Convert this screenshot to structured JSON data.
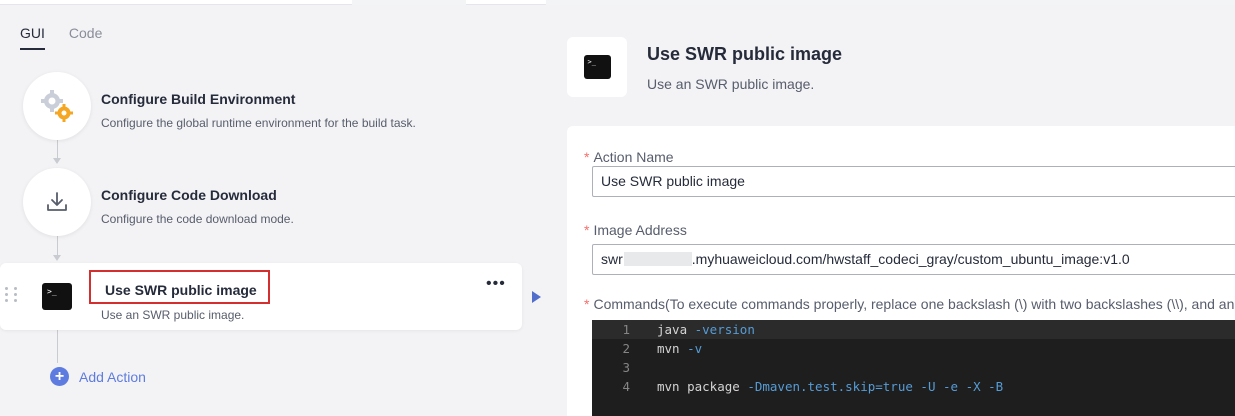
{
  "tabs": [
    {
      "label": "GUI",
      "active": true
    },
    {
      "label": "Code",
      "active": false
    }
  ],
  "steps": [
    {
      "title": "Configure Build Environment",
      "description": "Configure the global runtime environment for the build task.",
      "icon": "gear-icon"
    },
    {
      "title": "Configure Code Download",
      "description": "Configure the code download mode.",
      "icon": "download-icon"
    }
  ],
  "active_step": {
    "title": "Use SWR public image",
    "description": "Use an SWR public image.",
    "icon": "terminal-icon",
    "more_label": "•••"
  },
  "add_action": {
    "icon_glyph": "+",
    "label": "Add Action"
  },
  "detail": {
    "title": "Use SWR public image",
    "description": "Use an SWR public image.",
    "icon": "terminal-icon",
    "fields": {
      "action_name": {
        "required_mark": "*",
        "label": "Action Name",
        "value": "Use SWR public image"
      },
      "image_address": {
        "required_mark": "*",
        "label": "Image Address",
        "value_prefix": "swr",
        "value_suffix": ".myhuaweicloud.com/hwstaff_codeci_gray/custom_ubuntu_image:v1.0"
      },
      "commands": {
        "required_mark": "*",
        "label": "Commands(To execute commands properly, replace one backslash (\\) with two backslashes (\\\\), and an"
      }
    },
    "code_lines": [
      {
        "num": "1",
        "text": "java",
        "flags": " -version"
      },
      {
        "num": "2",
        "text": "mvn",
        "flags": " -v"
      },
      {
        "num": "3",
        "text": "",
        "flags": ""
      },
      {
        "num": "4",
        "text": "mvn package",
        "flags": " -Dmaven.test.skip=true -U -e -X -B"
      }
    ]
  },
  "colors": {
    "accent": "#5e7ce0",
    "highlight_border": "#d32f2f",
    "required": "#f66f6a",
    "editor_bg": "#1e1e1e"
  }
}
